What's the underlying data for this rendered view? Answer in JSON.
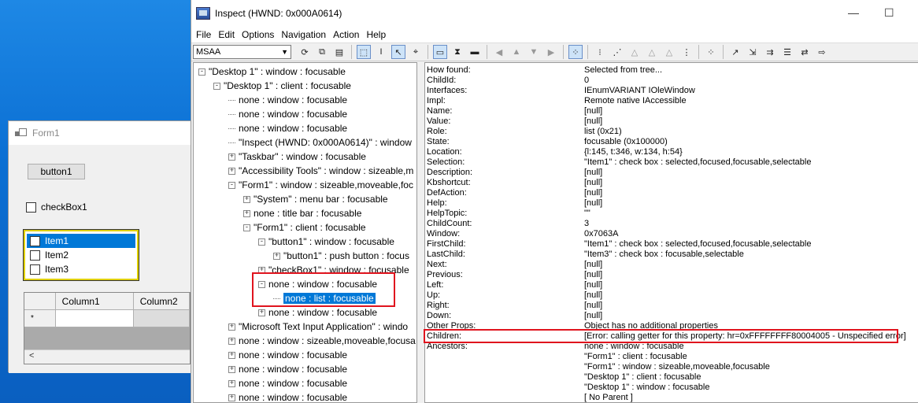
{
  "form1": {
    "title": "Form1",
    "button_label": "button1",
    "checkbox_label": "checkBox1",
    "list_items": [
      "Item1",
      "Item2",
      "Item3"
    ],
    "grid_columns": [
      "Column1",
      "Column2"
    ],
    "new_row_marker": "*",
    "scroll_left": "<"
  },
  "inspect": {
    "title": "Inspect  (HWND: 0x000A0614)",
    "minimize": "—",
    "maximize": "☐",
    "menu": [
      "File",
      "Edit",
      "Options",
      "Navigation",
      "Action",
      "Help"
    ],
    "mode": "MSAA",
    "tree": [
      {
        "label": "\"Desktop 1\" : window : focusable",
        "depth": 0,
        "exp": "-"
      },
      {
        "label": "\"Desktop 1\" : client : focusable",
        "depth": 1,
        "exp": "-"
      },
      {
        "label": "none : window : focusable",
        "depth": 2,
        "exp": ""
      },
      {
        "label": "none : window : focusable",
        "depth": 2,
        "exp": ""
      },
      {
        "label": "none : window : focusable",
        "depth": 2,
        "exp": ""
      },
      {
        "label": "\"Inspect  (HWND: 0x000A0614)\" : window",
        "depth": 2,
        "exp": ""
      },
      {
        "label": "\"Taskbar\" : window : focusable",
        "depth": 2,
        "exp": "+"
      },
      {
        "label": "\"Accessibility Tools\" : window : sizeable,m",
        "depth": 2,
        "exp": "+"
      },
      {
        "label": "\"Form1\" : window : sizeable,moveable,foc",
        "depth": 2,
        "exp": "-"
      },
      {
        "label": "\"System\" : menu bar : focusable",
        "depth": 3,
        "exp": "+"
      },
      {
        "label": "none : title bar : focusable",
        "depth": 3,
        "exp": "+"
      },
      {
        "label": "\"Form1\" : client : focusable",
        "depth": 3,
        "exp": "-"
      },
      {
        "label": "\"button1\" : window : focusable",
        "depth": 4,
        "exp": "-"
      },
      {
        "label": "\"button1\" : push button : focus",
        "depth": 5,
        "exp": "+"
      },
      {
        "label": "\"checkBox1\" : window : focusable",
        "depth": 4,
        "exp": "+"
      },
      {
        "label": "none : window : focusable",
        "depth": 4,
        "exp": "-"
      },
      {
        "label": "none : list : focusable",
        "depth": 5,
        "exp": "",
        "selected": true
      },
      {
        "label": "none : window : focusable",
        "depth": 4,
        "exp": "+"
      },
      {
        "label": "\"Microsoft Text Input Application\" : windo",
        "depth": 2,
        "exp": "+"
      },
      {
        "label": "none : window : sizeable,moveable,focusa",
        "depth": 2,
        "exp": "+"
      },
      {
        "label": "none : window : focusable",
        "depth": 2,
        "exp": "+"
      },
      {
        "label": "none : window : focusable",
        "depth": 2,
        "exp": "+"
      },
      {
        "label": "none : window : focusable",
        "depth": 2,
        "exp": "+"
      },
      {
        "label": "none : window : focusable",
        "depth": 2,
        "exp": "+"
      }
    ],
    "properties": [
      {
        "name": "How found:",
        "value": "Selected from tree..."
      },
      {
        "name": "ChildId:",
        "value": "0"
      },
      {
        "name": "Interfaces:",
        "value": "IEnumVARIANT IOleWindow"
      },
      {
        "name": "Impl:",
        "value": "Remote native IAccessible"
      },
      {
        "name": "Name:",
        "value": "[null]"
      },
      {
        "name": "Value:",
        "value": "[null]"
      },
      {
        "name": "Role:",
        "value": "list (0x21)"
      },
      {
        "name": "State:",
        "value": "focusable (0x100000)"
      },
      {
        "name": "Location:",
        "value": "{l:145, t:346, w:134, h:54}"
      },
      {
        "name": "Selection:",
        "value": "\"Item1\" : check box : selected,focused,focusable,selectable"
      },
      {
        "name": "Description:",
        "value": "[null]"
      },
      {
        "name": "Kbshortcut:",
        "value": "[null]"
      },
      {
        "name": "DefAction:",
        "value": "[null]"
      },
      {
        "name": "Help:",
        "value": "[null]"
      },
      {
        "name": "HelpTopic:",
        "value": "\"\""
      },
      {
        "name": "ChildCount:",
        "value": "3"
      },
      {
        "name": "Window:",
        "value": "0x7063A"
      },
      {
        "name": "FirstChild:",
        "value": "\"Item1\" : check box : selected,focused,focusable,selectable"
      },
      {
        "name": "LastChild:",
        "value": "\"Item3\" : check box : focusable,selectable"
      },
      {
        "name": "Next:",
        "value": "[null]"
      },
      {
        "name": "Previous:",
        "value": "[null]"
      },
      {
        "name": "Left:",
        "value": "[null]"
      },
      {
        "name": "Up:",
        "value": "[null]"
      },
      {
        "name": "Right:",
        "value": "[null]"
      },
      {
        "name": "Down:",
        "value": "[null]"
      },
      {
        "name": "Other Props:",
        "value": "Object has no additional properties"
      },
      {
        "name": "Children:",
        "value": "[Error: calling getter for this property: hr=0xFFFFFFFF80004005 - Unspecified error]"
      },
      {
        "name": "Ancestors:",
        "value": "none : window : focusable"
      },
      {
        "name": "",
        "value": "\"Form1\" : client : focusable"
      },
      {
        "name": "",
        "value": "\"Form1\" : window : sizeable,moveable,focusable"
      },
      {
        "name": "",
        "value": "\"Desktop 1\" : client : focusable"
      },
      {
        "name": "",
        "value": "\"Desktop 1\" : window : focusable"
      },
      {
        "name": "",
        "value": "[ No Parent ]"
      }
    ],
    "highlight_color": "#e0141e",
    "selection_color": "#0078d7"
  }
}
